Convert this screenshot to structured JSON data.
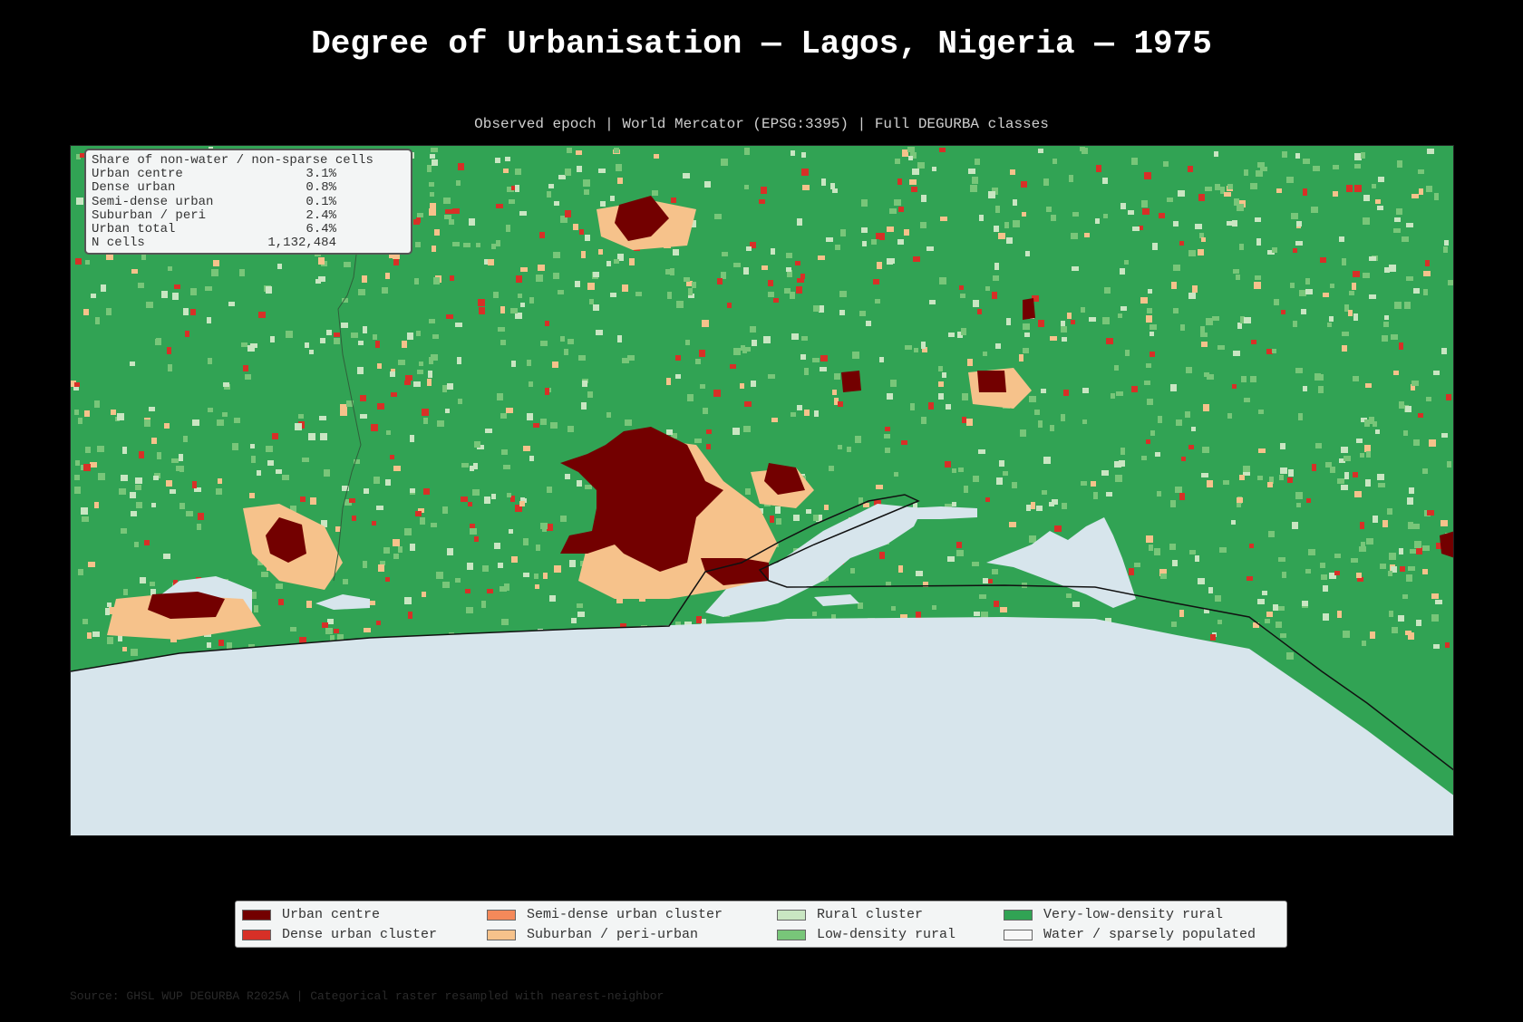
{
  "title": "Degree of Urbanisation — Lagos, Nigeria — 1975",
  "subtitle": "Observed epoch | World Mercator (EPSG:3395) | Full DEGURBA classes",
  "stats": {
    "heading": "Share of non-water / non-sparse cells",
    "rows": [
      {
        "label": "Urban centre",
        "value": "3.1%"
      },
      {
        "label": "Dense urban",
        "value": "0.8%"
      },
      {
        "label": "Semi-dense urban",
        "value": "0.1%"
      },
      {
        "label": "Suburban / peri",
        "value": "2.4%"
      },
      {
        "label": "Urban total",
        "value": "6.4%"
      },
      {
        "label": "N cells",
        "value": "1,132,484"
      }
    ]
  },
  "legend": [
    {
      "label": "Urban centre",
      "color": "#730000"
    },
    {
      "label": "Dense urban cluster",
      "color": "#d73027"
    },
    {
      "label": "Semi-dense urban cluster",
      "color": "#f4895a"
    },
    {
      "label": "Suburban / peri-urban",
      "color": "#f6c28b"
    },
    {
      "label": "Rural cluster",
      "color": "#c9e6c2"
    },
    {
      "label": "Low-density rural",
      "color": "#78c679"
    },
    {
      "label": "Very-low-density rural",
      "color": "#31a354"
    },
    {
      "label": "Water / sparsely populated",
      "color": "#f7f7f7"
    }
  ],
  "colors": {
    "water": "#d7e5ec",
    "land": "#31a354"
  },
  "source": "Source: GHSL WUP DEGURBA R2025A | Categorical raster resampled with nearest-neighbor"
}
